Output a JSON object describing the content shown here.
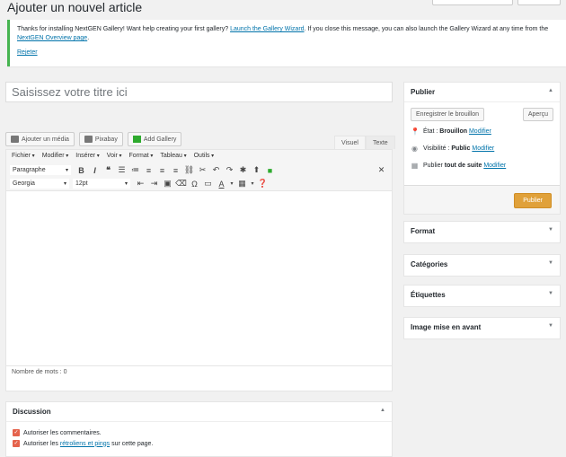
{
  "page": {
    "title": "Ajouter un nouvel article"
  },
  "notice": {
    "text_before": "Thanks for installing NextGEN Gallery! Want help creating your first gallery? ",
    "wizard_link": "Launch the Gallery Wizard",
    "text_middle": ". If you close this message, you can also launch the Gallery Wizard at any time from the ",
    "overview_link": "NextGEN Overview page",
    "text_after": ".",
    "dismiss": "Rejeter"
  },
  "title_field": {
    "placeholder": "Saisissez votre titre ici"
  },
  "media_buttons": {
    "add_media": "Ajouter un média",
    "pixabay": "Pixabay",
    "add_gallery": "Add Gallery"
  },
  "editor_tabs": {
    "visual": "Visuel",
    "text": "Texte"
  },
  "menubar": [
    "Fichier",
    "Modifier",
    "Insérer",
    "Voir",
    "Format",
    "Tableau",
    "Outils"
  ],
  "toolbar": {
    "paragraph": "Paragraphe",
    "font": "Georgia",
    "size": "12pt"
  },
  "status": {
    "word_count": "Nombre de mots : 0"
  },
  "discussion": {
    "title": "Discussion",
    "allow_comments": "Autoriser les commentaires.",
    "trackbacks_before": "Autoriser les ",
    "trackbacks_link": "rétroliens et pings",
    "trackbacks_after": " sur cette page."
  },
  "publish": {
    "title": "Publier",
    "save_draft": "Enregistrer le brouillon",
    "preview": "Aperçu",
    "status_label": "État : ",
    "status_value": "Brouillon",
    "visibility_label": "Visibilité : ",
    "visibility_value": "Public",
    "publish_label": "Publier ",
    "publish_value": "tout de suite",
    "edit": "Modifier",
    "publish_button": "Publier"
  },
  "boxes": {
    "format": "Format",
    "categories": "Catégories",
    "tags": "Étiquettes",
    "featured": "Image mise en avant"
  }
}
